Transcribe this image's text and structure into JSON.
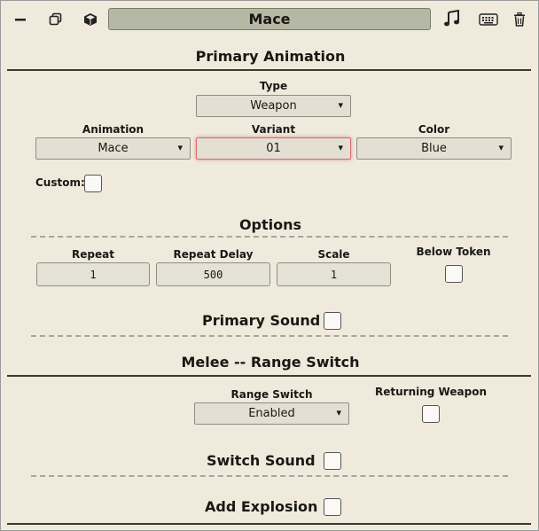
{
  "header": {
    "title": "Mace",
    "icons": [
      "minimize-icon",
      "copy-icon",
      "cube-icon",
      "music-icon",
      "keyboard-icon",
      "trash-icon"
    ]
  },
  "primary_animation": {
    "title": "Primary Animation",
    "type_label": "Type",
    "type_value": "Weapon",
    "animation_label": "Animation",
    "animation_value": "Mace",
    "variant_label": "Variant",
    "variant_value": "01",
    "color_label": "Color",
    "color_value": "Blue",
    "custom_label": "Custom:"
  },
  "options": {
    "title": "Options",
    "repeat_label": "Repeat",
    "repeat_value": "1",
    "repeat_delay_label": "Repeat Delay",
    "repeat_delay_value": "500",
    "scale_label": "Scale",
    "scale_value": "1",
    "below_token_label": "Below Token"
  },
  "primary_sound": {
    "label": "Primary Sound"
  },
  "melee_range": {
    "title": "Melee -- Range Switch",
    "range_switch_label": "Range Switch",
    "range_switch_value": "Enabled",
    "returning_weapon_label": "Returning Weapon"
  },
  "switch_sound": {
    "label": "Switch Sound"
  },
  "add_explosion": {
    "label": "Add Explosion"
  }
}
